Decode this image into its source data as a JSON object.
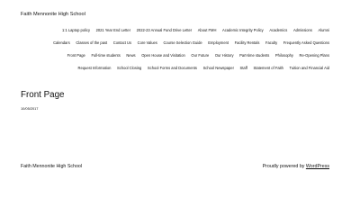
{
  "header": {
    "site_title": "Faith Mennonite High School"
  },
  "nav": {
    "rows": [
      [
        "1:1 Laptop policy",
        "2021 Year End Letter",
        "2022-23 Annual Fund Drive Letter",
        "About FMH",
        "Academic Integrity Policy",
        "Academics",
        "Admissions",
        "Alumni"
      ],
      [
        "Calendars",
        "Classes of the past",
        "Contact Us",
        "Core Values",
        "Course Selection Guide",
        "Employment",
        "Facility Rentals",
        "Faculty",
        "Frequently Asked Questions"
      ],
      [
        "Front Page",
        "Full-time students",
        "News",
        "Open House and Visitation",
        "Our Future",
        "Our History",
        "Part-time students",
        "Philosophy",
        "Re-Opening Plans"
      ],
      [
        "Request Information",
        "School Closing",
        "School Forms and Documents",
        "School Newspaper",
        "Staff",
        "Statement of Faith",
        "Tuition and Financial Aid"
      ]
    ]
  },
  "main": {
    "title": "Front Page",
    "date": "10/05/2017"
  },
  "footer": {
    "site_title": "Faith Mennonite High School",
    "credit_prefix": "Proudly powered by ",
    "credit_link": "WordPress"
  }
}
